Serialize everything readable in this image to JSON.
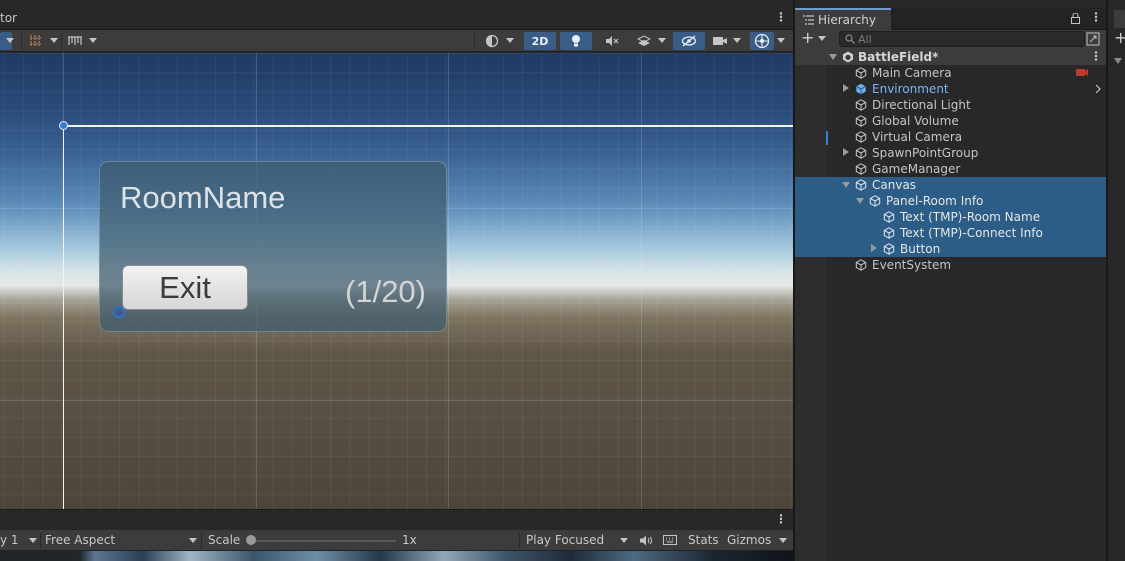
{
  "scene_view": {
    "tab_label": "tor",
    "toolbar": {
      "mode_2d": "2D"
    },
    "ui": {
      "room_name": "RoomName",
      "exit_label": "Exit",
      "connect_info": "(1/20)"
    }
  },
  "game_view": {
    "display": "y 1",
    "aspect": "Free Aspect",
    "scale_label": "Scale",
    "scale_value": "1x",
    "scale_fraction": 0,
    "play_mode": "Play Focused",
    "stats": "Stats",
    "gizmos": "Gizmos"
  },
  "hierarchy": {
    "tab_label": "Hierarchy",
    "add_label": "+",
    "search_placeholder": "All",
    "scene_name": "BattleField*",
    "items": [
      {
        "label": "Main Camera"
      },
      {
        "label": "Environment"
      },
      {
        "label": "Directional Light"
      },
      {
        "label": "Global Volume"
      },
      {
        "label": "Virtual Camera"
      },
      {
        "label": "SpawnPointGroup"
      },
      {
        "label": "GameManager"
      },
      {
        "label": "Canvas"
      },
      {
        "label": "Panel-Room Info"
      },
      {
        "label": "Text (TMP)-Room Name"
      },
      {
        "label": "Text (TMP)-Connect Info"
      },
      {
        "label": "Button"
      },
      {
        "label": "EventSystem"
      }
    ]
  },
  "colors": {
    "selection": "#2c5d87",
    "prefab_text": "#7ab4f7",
    "accent": "#3a5d87"
  }
}
